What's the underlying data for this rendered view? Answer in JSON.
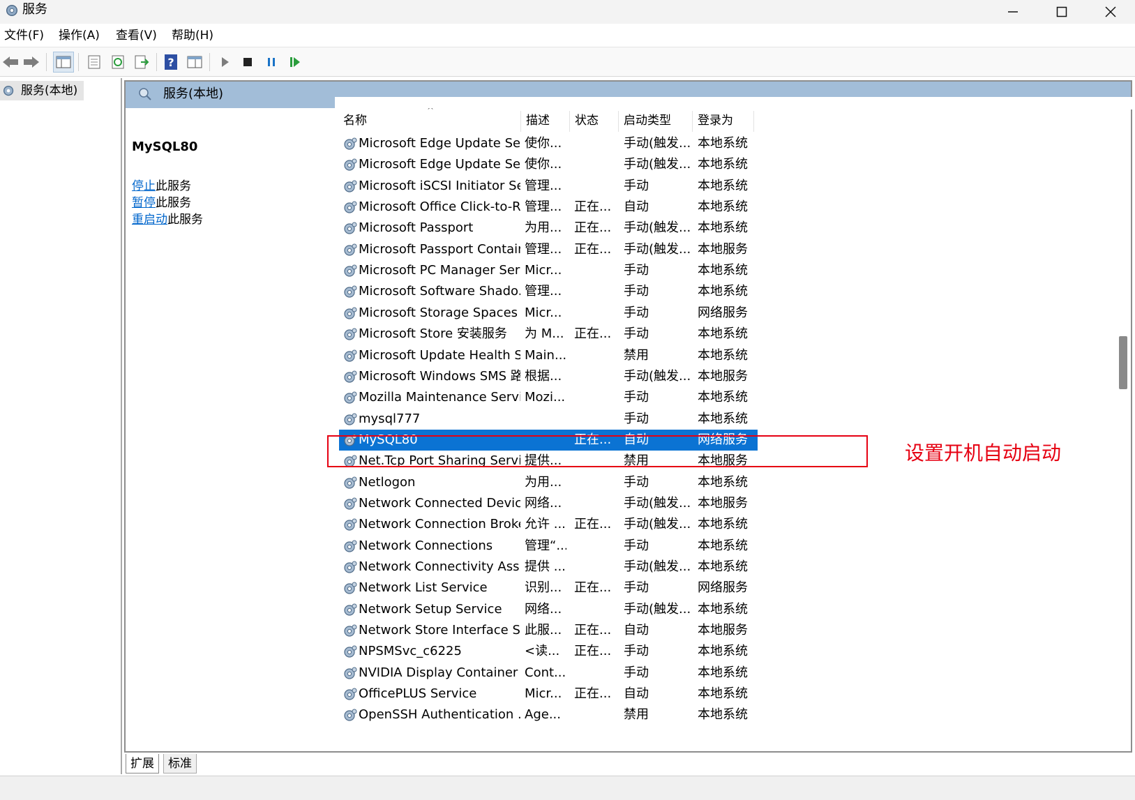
{
  "window": {
    "title": "服务",
    "controls": {
      "minimize": "—",
      "maximize": "☐",
      "close": "✕"
    }
  },
  "menu": [
    "文件(F)",
    "操作(A)",
    "查看(V)",
    "帮助(H)"
  ],
  "toolbar": {
    "buttons": [
      "back",
      "forward",
      "show-hide-console-tree",
      "properties",
      "refresh",
      "export-list",
      "help",
      "console-view",
      "start",
      "stop",
      "pause",
      "resume"
    ]
  },
  "tree": {
    "root_label": "服务(本地)"
  },
  "panel": {
    "header": "服务(本地)",
    "selected_service": "MySQL80",
    "actions": [
      {
        "link": "停止",
        "rest": "此服务"
      },
      {
        "link": "暂停",
        "rest": "此服务"
      },
      {
        "link": "重启动",
        "rest": "此服务"
      }
    ]
  },
  "columns": {
    "name": "名称",
    "desc": "描述",
    "status": "状态",
    "startup": "启动类型",
    "logon": "登录为"
  },
  "services": [
    {
      "name": "Microsoft Edge Update Ser...",
      "desc": "使你...",
      "status": "",
      "startup": "手动(触发...",
      "logon": "本地系统"
    },
    {
      "name": "Microsoft Edge Update Ser...",
      "desc": "使你...",
      "status": "",
      "startup": "手动(触发...",
      "logon": "本地系统"
    },
    {
      "name": "Microsoft iSCSI Initiator Ser...",
      "desc": "管理...",
      "status": "",
      "startup": "手动",
      "logon": "本地系统"
    },
    {
      "name": "Microsoft Office Click-to-R...",
      "desc": "管理...",
      "status": "正在...",
      "startup": "自动",
      "logon": "本地系统"
    },
    {
      "name": "Microsoft Passport",
      "desc": "为用...",
      "status": "正在...",
      "startup": "手动(触发...",
      "logon": "本地系统"
    },
    {
      "name": "Microsoft Passport Container",
      "desc": "管理...",
      "status": "正在...",
      "startup": "手动(触发...",
      "logon": "本地服务"
    },
    {
      "name": "Microsoft PC Manager Serv...",
      "desc": "Micr...",
      "status": "",
      "startup": "手动",
      "logon": "本地系统"
    },
    {
      "name": "Microsoft Software Shado...",
      "desc": "管理...",
      "status": "",
      "startup": "手动",
      "logon": "本地系统"
    },
    {
      "name": "Microsoft Storage Spaces S...",
      "desc": "Micr...",
      "status": "",
      "startup": "手动",
      "logon": "网络服务"
    },
    {
      "name": "Microsoft Store 安装服务",
      "desc": "为 M...",
      "status": "正在...",
      "startup": "手动",
      "logon": "本地系统"
    },
    {
      "name": "Microsoft Update Health S...",
      "desc": "Main...",
      "status": "",
      "startup": "禁用",
      "logon": "本地系统"
    },
    {
      "name": "Microsoft Windows SMS 路...",
      "desc": "根据...",
      "status": "",
      "startup": "手动(触发...",
      "logon": "本地服务"
    },
    {
      "name": "Mozilla Maintenance Service",
      "desc": "Mozi...",
      "status": "",
      "startup": "手动",
      "logon": "本地系统"
    },
    {
      "name": "mysql777",
      "desc": "",
      "status": "",
      "startup": "手动",
      "logon": "本地系统"
    },
    {
      "name": "MySQL80",
      "desc": "",
      "status": "正在...",
      "startup": "自动",
      "logon": "网络服务",
      "selected": true
    },
    {
      "name": "Net.Tcp Port Sharing Service",
      "desc": "提供...",
      "status": "",
      "startup": "禁用",
      "logon": "本地服务"
    },
    {
      "name": "Netlogon",
      "desc": "为用...",
      "status": "",
      "startup": "手动",
      "logon": "本地系统"
    },
    {
      "name": "Network Connected Devic...",
      "desc": "网络...",
      "status": "",
      "startup": "手动(触发...",
      "logon": "本地服务"
    },
    {
      "name": "Network Connection Broker",
      "desc": "允许 ...",
      "status": "正在...",
      "startup": "手动(触发...",
      "logon": "本地系统"
    },
    {
      "name": "Network Connections",
      "desc": "管理“...",
      "status": "",
      "startup": "手动",
      "logon": "本地系统"
    },
    {
      "name": "Network Connectivity Assis...",
      "desc": "提供 ...",
      "status": "",
      "startup": "手动(触发...",
      "logon": "本地系统"
    },
    {
      "name": "Network List Service",
      "desc": "识别...",
      "status": "正在...",
      "startup": "手动",
      "logon": "网络服务"
    },
    {
      "name": "Network Setup Service",
      "desc": "网络...",
      "status": "",
      "startup": "手动(触发...",
      "logon": "本地系统"
    },
    {
      "name": "Network Store Interface Se...",
      "desc": "此服...",
      "status": "正在...",
      "startup": "自动",
      "logon": "本地服务"
    },
    {
      "name": "NPSMSvc_c6225",
      "desc": "<读...",
      "status": "正在...",
      "startup": "手动",
      "logon": "本地系统"
    },
    {
      "name": "NVIDIA Display Container LS",
      "desc": "Cont...",
      "status": "",
      "startup": "手动",
      "logon": "本地系统"
    },
    {
      "name": "OfficePLUS Service",
      "desc": "Micr...",
      "status": "正在...",
      "startup": "自动",
      "logon": "本地系统"
    },
    {
      "name": "OpenSSH Authentication ...",
      "desc": "Age...",
      "status": "",
      "startup": "禁用",
      "logon": "本地系统"
    }
  ],
  "tabs": [
    "扩展",
    "标准"
  ],
  "annotation": {
    "text": "设置开机自动启动",
    "color": "#e60012"
  },
  "colors": {
    "selection": "#0b73d3",
    "panel_header": "#a2bdd8",
    "link": "#0066cc"
  }
}
